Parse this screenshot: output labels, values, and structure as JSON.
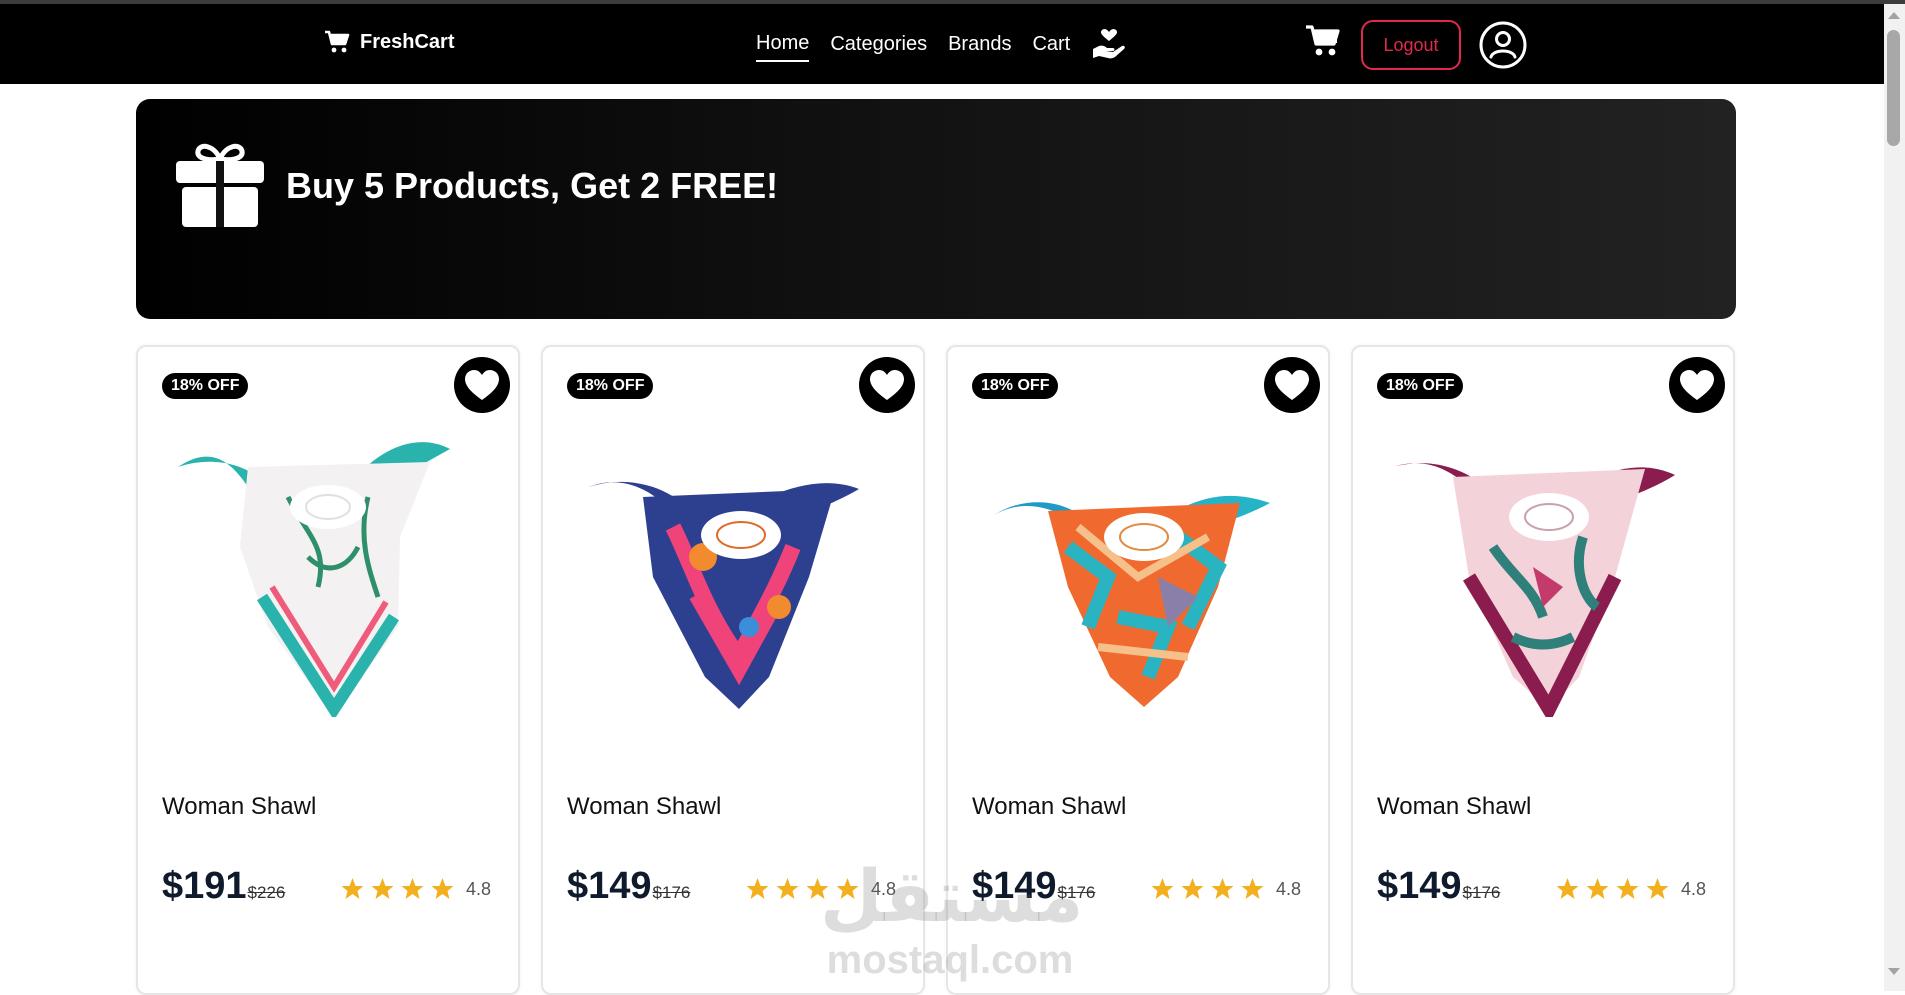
{
  "brand": {
    "name": "FreshCart",
    "icon": "cart-icon"
  },
  "nav": {
    "links": [
      {
        "label": "Home",
        "active": true
      },
      {
        "label": "Categories",
        "active": false
      },
      {
        "label": "Brands",
        "active": false
      },
      {
        "label": "Cart",
        "active": false
      }
    ],
    "hand_icon": "hand-heart-icon"
  },
  "header_actions": {
    "cart_icon": "shopping-cart-icon",
    "logout_label": "Logout",
    "profile_icon": "user-circle-icon"
  },
  "promo": {
    "icon": "gift-icon",
    "text": "Buy 5 Products, Get 2 FREE!"
  },
  "products": [
    {
      "badge": "18% OFF",
      "name": "Woman Shawl",
      "price": "$191",
      "old_price": "$226",
      "rating": "4.8",
      "stars": 4,
      "scarf": "teal-floral"
    },
    {
      "badge": "18% OFF",
      "name": "Woman Shawl",
      "price": "$149",
      "old_price": "$176",
      "rating": "4.8",
      "stars": 4,
      "scarf": "navy-pink"
    },
    {
      "badge": "18% OFF",
      "name": "Woman Shawl",
      "price": "$149",
      "old_price": "$176",
      "rating": "4.8",
      "stars": 4,
      "scarf": "orange-teal"
    },
    {
      "badge": "18% OFF",
      "name": "Woman Shawl",
      "price": "$149",
      "old_price": "$176",
      "rating": "4.8",
      "stars": 4,
      "scarf": "burgundy-pink"
    }
  ],
  "watermark": {
    "arabic": "مستقل",
    "latin": "mostaql.com"
  },
  "colors": {
    "navbar": "#000000",
    "logout_accent": "#e0294c",
    "star": "#f2b01e",
    "price": "#0f1a2c"
  }
}
